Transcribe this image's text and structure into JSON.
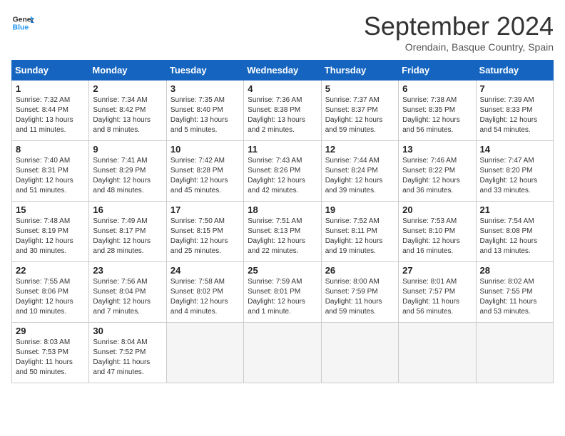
{
  "header": {
    "logo_line1": "General",
    "logo_line2": "Blue",
    "month_year": "September 2024",
    "location": "Orendain, Basque Country, Spain"
  },
  "days_of_week": [
    "Sunday",
    "Monday",
    "Tuesday",
    "Wednesday",
    "Thursday",
    "Friday",
    "Saturday"
  ],
  "weeks": [
    [
      {
        "day": "1",
        "info": "Sunrise: 7:32 AM\nSunset: 8:44 PM\nDaylight: 13 hours and 11 minutes."
      },
      {
        "day": "2",
        "info": "Sunrise: 7:34 AM\nSunset: 8:42 PM\nDaylight: 13 hours and 8 minutes."
      },
      {
        "day": "3",
        "info": "Sunrise: 7:35 AM\nSunset: 8:40 PM\nDaylight: 13 hours and 5 minutes."
      },
      {
        "day": "4",
        "info": "Sunrise: 7:36 AM\nSunset: 8:38 PM\nDaylight: 13 hours and 2 minutes."
      },
      {
        "day": "5",
        "info": "Sunrise: 7:37 AM\nSunset: 8:37 PM\nDaylight: 12 hours and 59 minutes."
      },
      {
        "day": "6",
        "info": "Sunrise: 7:38 AM\nSunset: 8:35 PM\nDaylight: 12 hours and 56 minutes."
      },
      {
        "day": "7",
        "info": "Sunrise: 7:39 AM\nSunset: 8:33 PM\nDaylight: 12 hours and 54 minutes."
      }
    ],
    [
      {
        "day": "8",
        "info": "Sunrise: 7:40 AM\nSunset: 8:31 PM\nDaylight: 12 hours and 51 minutes."
      },
      {
        "day": "9",
        "info": "Sunrise: 7:41 AM\nSunset: 8:29 PM\nDaylight: 12 hours and 48 minutes."
      },
      {
        "day": "10",
        "info": "Sunrise: 7:42 AM\nSunset: 8:28 PM\nDaylight: 12 hours and 45 minutes."
      },
      {
        "day": "11",
        "info": "Sunrise: 7:43 AM\nSunset: 8:26 PM\nDaylight: 12 hours and 42 minutes."
      },
      {
        "day": "12",
        "info": "Sunrise: 7:44 AM\nSunset: 8:24 PM\nDaylight: 12 hours and 39 minutes."
      },
      {
        "day": "13",
        "info": "Sunrise: 7:46 AM\nSunset: 8:22 PM\nDaylight: 12 hours and 36 minutes."
      },
      {
        "day": "14",
        "info": "Sunrise: 7:47 AM\nSunset: 8:20 PM\nDaylight: 12 hours and 33 minutes."
      }
    ],
    [
      {
        "day": "15",
        "info": "Sunrise: 7:48 AM\nSunset: 8:19 PM\nDaylight: 12 hours and 30 minutes."
      },
      {
        "day": "16",
        "info": "Sunrise: 7:49 AM\nSunset: 8:17 PM\nDaylight: 12 hours and 28 minutes."
      },
      {
        "day": "17",
        "info": "Sunrise: 7:50 AM\nSunset: 8:15 PM\nDaylight: 12 hours and 25 minutes."
      },
      {
        "day": "18",
        "info": "Sunrise: 7:51 AM\nSunset: 8:13 PM\nDaylight: 12 hours and 22 minutes."
      },
      {
        "day": "19",
        "info": "Sunrise: 7:52 AM\nSunset: 8:11 PM\nDaylight: 12 hours and 19 minutes."
      },
      {
        "day": "20",
        "info": "Sunrise: 7:53 AM\nSunset: 8:10 PM\nDaylight: 12 hours and 16 minutes."
      },
      {
        "day": "21",
        "info": "Sunrise: 7:54 AM\nSunset: 8:08 PM\nDaylight: 12 hours and 13 minutes."
      }
    ],
    [
      {
        "day": "22",
        "info": "Sunrise: 7:55 AM\nSunset: 8:06 PM\nDaylight: 12 hours and 10 minutes."
      },
      {
        "day": "23",
        "info": "Sunrise: 7:56 AM\nSunset: 8:04 PM\nDaylight: 12 hours and 7 minutes."
      },
      {
        "day": "24",
        "info": "Sunrise: 7:58 AM\nSunset: 8:02 PM\nDaylight: 12 hours and 4 minutes."
      },
      {
        "day": "25",
        "info": "Sunrise: 7:59 AM\nSunset: 8:01 PM\nDaylight: 12 hours and 1 minute."
      },
      {
        "day": "26",
        "info": "Sunrise: 8:00 AM\nSunset: 7:59 PM\nDaylight: 11 hours and 59 minutes."
      },
      {
        "day": "27",
        "info": "Sunrise: 8:01 AM\nSunset: 7:57 PM\nDaylight: 11 hours and 56 minutes."
      },
      {
        "day": "28",
        "info": "Sunrise: 8:02 AM\nSunset: 7:55 PM\nDaylight: 11 hours and 53 minutes."
      }
    ],
    [
      {
        "day": "29",
        "info": "Sunrise: 8:03 AM\nSunset: 7:53 PM\nDaylight: 11 hours and 50 minutes."
      },
      {
        "day": "30",
        "info": "Sunrise: 8:04 AM\nSunset: 7:52 PM\nDaylight: 11 hours and 47 minutes."
      },
      null,
      null,
      null,
      null,
      null
    ]
  ]
}
